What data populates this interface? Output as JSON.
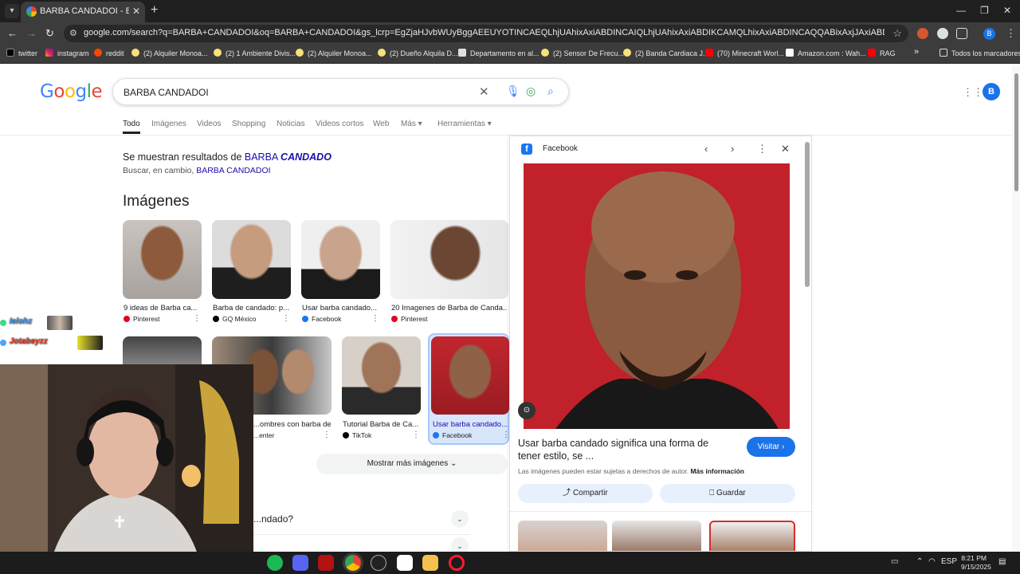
{
  "browser": {
    "tab_title": "BARBA CANDADOI - Buscar co",
    "url": "google.com/search?q=BARBA+CANDADOI&oq=BARBA+CANDADOI&gs_lcrp=EgZjaHJvbWUyBggAEEUYOTINCAEQLhjUAhixAxiABDINCAIQLhjUAhixAxiABDIKCAMQLhixAxiABDINCAQQABixAxjJAxiABDINCAUQABiSAxiABBiKBTINCAYQABiSAxiAB...",
    "bookmarks": [
      "twitter",
      "instagram",
      "reddit",
      "(2) Alquiler Monoa...",
      "(2) 1 Ambiente Divis...",
      "(2) Alquiler Monoa...",
      "(2) Dueño Alquila D...",
      "Departamento en al...",
      "(2) Sensor De Frecu...",
      "(2) Banda Cardiaca J...",
      "(70) Minecraft Worl...",
      "Amazon.com : Wah...",
      "RAG"
    ],
    "bookmarks_overflow": "»",
    "all_bookmarks": "Todos los marcadores",
    "profile_initial": "B"
  },
  "google": {
    "logo": "Google",
    "query": "BARBA CANDADOI",
    "avatar_initial": "B",
    "filters": [
      "Todo",
      "Imágenes",
      "Videos",
      "Shopping",
      "Noticias",
      "Videos cortos",
      "Web",
      "Más ▾",
      "Herramientas ▾"
    ],
    "spell_prefix": "Se muestran resultados de ",
    "spell_word1": "BARBA ",
    "spell_word2": "CANDADO",
    "instead_prefix": "Buscar, en cambio, ",
    "instead_link": "BARBA CANDADOI",
    "images_heading": "Imágenes",
    "images_row1": [
      {
        "caption": "9 ideas de Barba ca...",
        "source": "Pinterest"
      },
      {
        "caption": "Barba de candado: p...",
        "source": "GQ México"
      },
      {
        "caption": "Usar barba candado...",
        "source": "Facebook"
      },
      {
        "caption": "20 Imagenes de Barba de Canda...",
        "source": "Pinterest"
      }
    ],
    "images_row2": [
      {
        "caption": "...ombres con barba de ...",
        "source": "...enter"
      },
      {
        "caption": "Tutorial Barba de Ca...",
        "source": "TikTok"
      },
      {
        "caption": "Usar barba candado...",
        "source": "Facebook"
      }
    ],
    "more_images": "Mostrar más imágenes",
    "paa_question": "...ndado?"
  },
  "panel": {
    "source": "Facebook",
    "title": "Usar barba candado significa una forma de tener estilo, se ...",
    "visit": "Visitar",
    "copyright": "Las imágenes pueden estar sujetas a derechos de autor.",
    "more_info": "Más información",
    "share": "Compartir",
    "save": "Guardar"
  },
  "stream_chat": [
    {
      "name": "Ielohz",
      "color": "#4da3ff"
    },
    {
      "name": "Jotabeyzz",
      "color": "#ff4a2e"
    }
  ],
  "taskbar": {
    "lang": "ESP",
    "time": "8:21 PM",
    "date": "9/15/2025"
  }
}
